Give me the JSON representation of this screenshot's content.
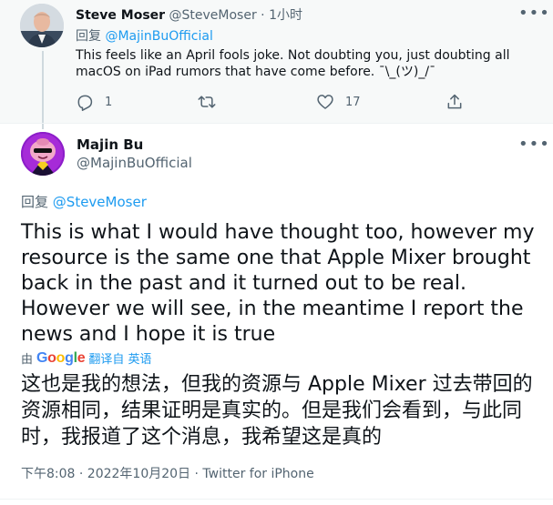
{
  "parent": {
    "name": "Steve Moser",
    "handle": "@SteveMoser",
    "dot": "·",
    "time": "1小时",
    "reply_prefix": "回复",
    "reply_mention": "@MajinBuOfficial",
    "text": "This feels like an April fools joke. Not doubting you, just doubting all macOS on iPad rumors that have come before. ¯\\_(ツ)_/¯",
    "more": "•••",
    "actions": {
      "reply_count": "1",
      "retweet_count": "",
      "like_count": "17"
    }
  },
  "tweet": {
    "name": "Majin Bu",
    "handle": "@MajinBuOfficial",
    "more": "•••",
    "reply_prefix": "回复",
    "reply_mention": "@SteveMoser",
    "text": "This is what I would have thought too, however my resource is the same one that Apple Mixer brought back in the past and it turned out to be real.  However we will see, in the meantime I report the news and I hope it is true",
    "translate_by": "由",
    "translate_service": "Google",
    "translate_action": "翻译自 英语",
    "translated_text": "这也是我的想法，但我的资源与 Apple Mixer 过去带回的资源相同，结果证明是真实的。但是我们会看到，与此同时，我报道了这个消息，我希望这是真的",
    "meta": "下午8:08 · 2022年10月20日 · Twitter for iPhone"
  },
  "colors": {
    "accent": "#1d9bf0",
    "secondary_text": "#536471",
    "primary_text": "#0f1419",
    "parent_background": "#f7f9f9"
  }
}
